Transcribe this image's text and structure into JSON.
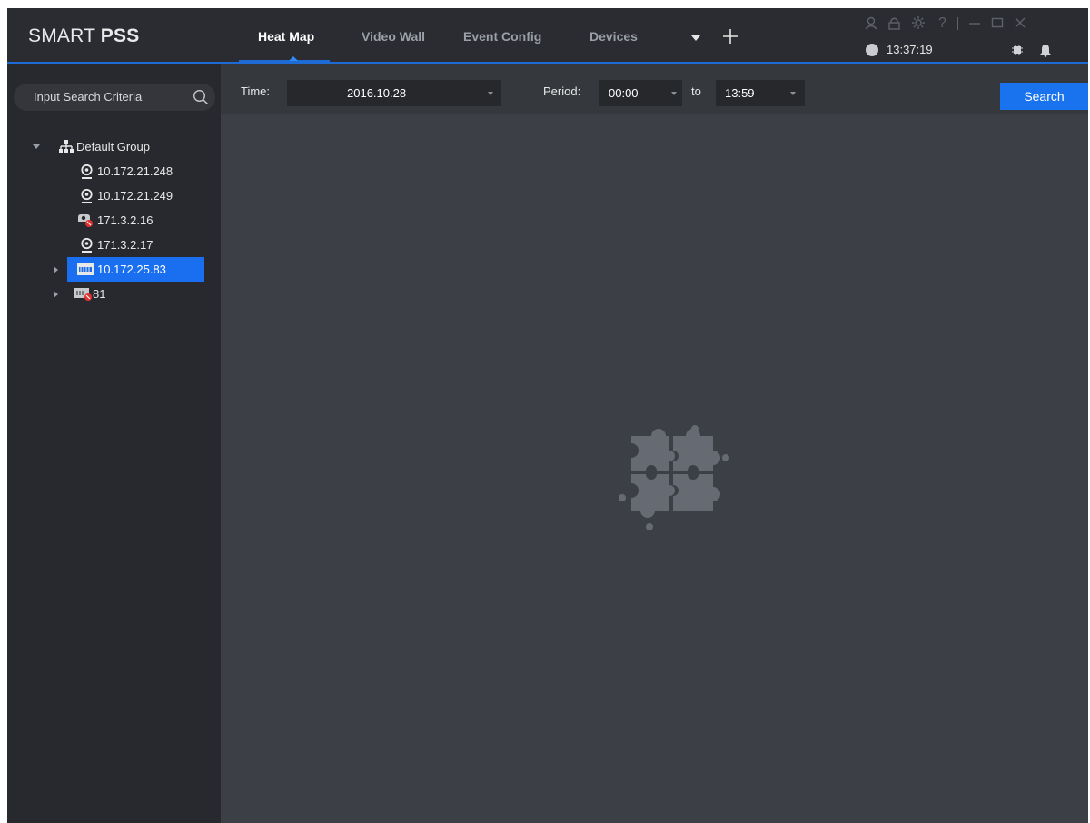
{
  "app": {
    "logo_light": "SMART ",
    "logo_bold": "PSS",
    "clock": "13:37:19"
  },
  "tabs": [
    {
      "label": "Heat Map",
      "active": true
    },
    {
      "label": "Video Wall",
      "active": false
    },
    {
      "label": "Event Config",
      "active": false
    },
    {
      "label": "Devices",
      "active": false
    }
  ],
  "sidebar": {
    "search_placeholder": "Input Search Criteria",
    "tree": {
      "group": {
        "label": "Default Group",
        "icon": "group-tree-icon",
        "expanded": true
      },
      "devices": [
        {
          "label": "10.172.21.248",
          "icon": "camera-icon",
          "status": "online"
        },
        {
          "label": "10.172.21.249",
          "icon": "camera-icon",
          "status": "online"
        },
        {
          "label": "171.3.2.16",
          "icon": "camera-offline-icon",
          "status": "offline"
        },
        {
          "label": "171.3.2.17",
          "icon": "camera-icon",
          "status": "online"
        },
        {
          "label": "10.172.25.83",
          "icon": "nvr-icon",
          "status": "online",
          "selected": true,
          "expandable": true
        },
        {
          "label": "81",
          "icon": "nvr-offline-icon",
          "status": "offline",
          "expandable": true
        }
      ]
    }
  },
  "toolbar": {
    "time_label": "Time:",
    "date_value": "2016.10.28",
    "period_label": "Period:",
    "period_start": "00:00",
    "to_label": "to",
    "period_end": "13:59",
    "search_label": "Search"
  },
  "colors": {
    "accent": "#1a73ee",
    "selected_row": "#1a6ef0",
    "offline_badge": "#e03030"
  }
}
